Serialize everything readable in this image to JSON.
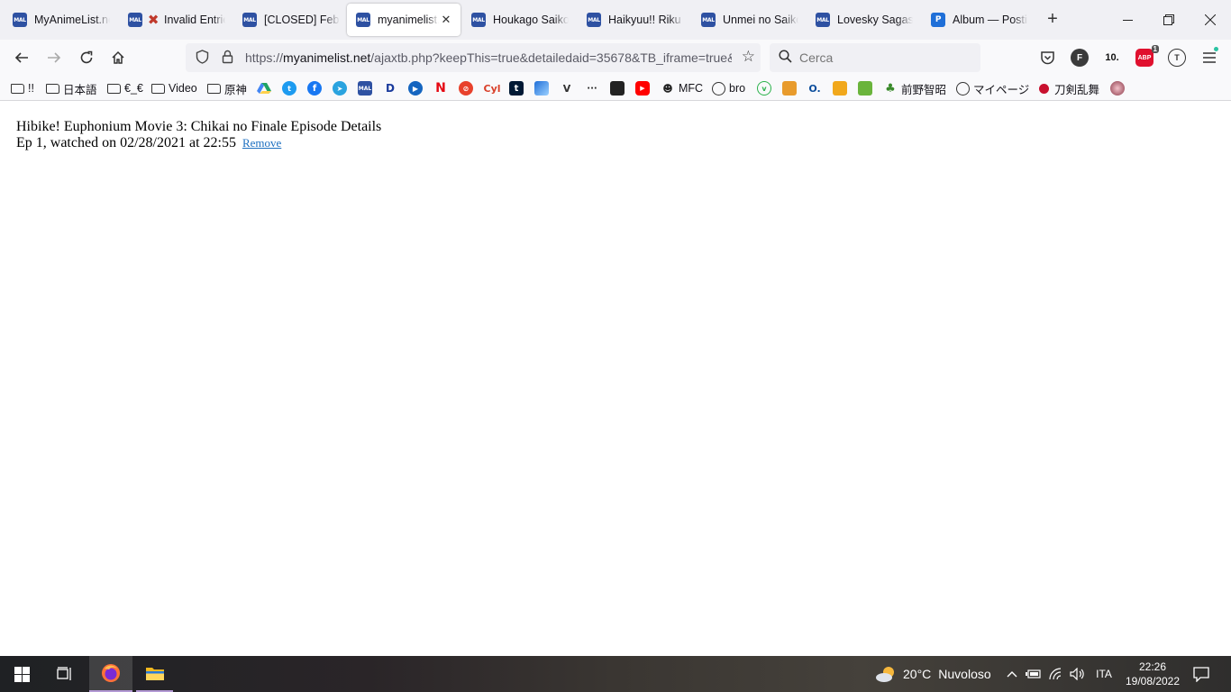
{
  "browser": {
    "tabs": [
      {
        "title": "MyAnimeList.net",
        "favicon": "mal-icon",
        "active": false
      },
      {
        "title": "Invalid Entries",
        "favicon": "x-mark-icon",
        "active": false
      },
      {
        "title": "[CLOSED] February",
        "favicon": "mal-icon",
        "active": false
      },
      {
        "title": "myanimelist.net",
        "favicon": "mal-icon",
        "active": true
      },
      {
        "title": "Houkago Saikoro",
        "favicon": "mal-icon",
        "active": false
      },
      {
        "title": "Haikyuu!! Riku vs",
        "favicon": "mal-icon",
        "active": false
      },
      {
        "title": "Unmei no Saikoro",
        "favicon": "mal-icon",
        "active": false
      },
      {
        "title": "Lovesky Sagashi",
        "favicon": "mal-icon",
        "active": false
      },
      {
        "title": "Album — Postimg",
        "favicon": "postimg-icon",
        "active": false
      }
    ],
    "favicon_text": "MAL",
    "url_scheme": "https://",
    "url_host": "myanimelist.net",
    "url_path": "/ajaxtb.php?keepThis=true&detailedaid=35678&TB_iframe=true&",
    "search_placeholder": "Cerca",
    "extensions": {
      "f_label": "F",
      "ten_label": "10.",
      "abp_label": "ABP",
      "abp_badge": "1",
      "t_label": "T"
    },
    "bookmarks": [
      {
        "label": "!!",
        "type": "folder"
      },
      {
        "label": "日本語",
        "type": "folder"
      },
      {
        "label": "€_€",
        "type": "folder"
      },
      {
        "label": "Video",
        "type": "folder"
      },
      {
        "label": "原神",
        "type": "folder"
      },
      {
        "label": "MFC",
        "type": "site"
      },
      {
        "label": "bro",
        "type": "globe"
      },
      {
        "label": "前野智昭",
        "type": "site"
      },
      {
        "label": "マイページ",
        "type": "globe"
      },
      {
        "label": "刀剣乱舞",
        "type": "site"
      }
    ]
  },
  "page": {
    "title": "Hibike! Euphonium Movie 3: Chikai no Finale Episode Details",
    "episode_text": "Ep 1, watched on 02/28/2021 at 22:55",
    "remove_link": "Remove"
  },
  "taskbar": {
    "weather_temp": "20°C",
    "weather_desc": "Nuvoloso",
    "language": "ITA",
    "time": "22:26",
    "date": "19/08/2022"
  },
  "colors": {
    "mal_blue": "#2e51a2",
    "link_blue": "#1c6fc0",
    "abp_red": "#e0102e"
  }
}
